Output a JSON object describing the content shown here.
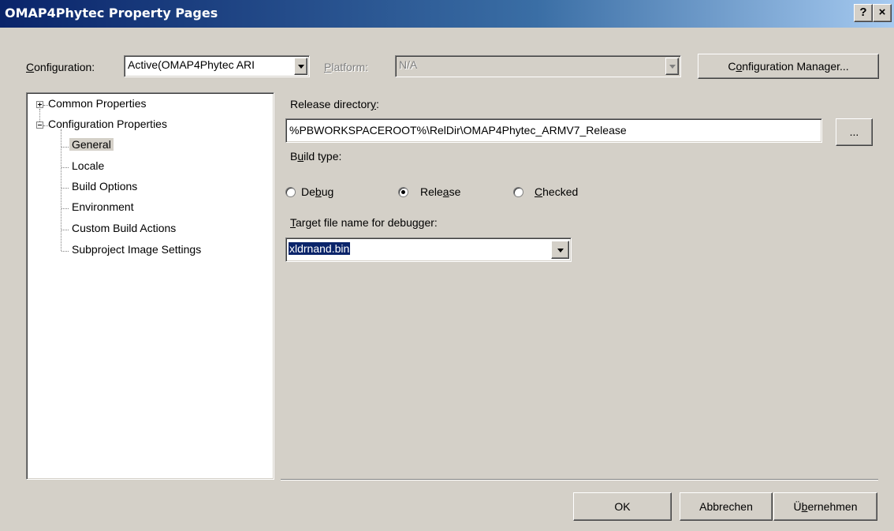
{
  "window": {
    "title": "OMAP4Phytec Property Pages",
    "help_button": "?",
    "close_button": "×"
  },
  "toolbar": {
    "configuration_label": "Configuration:",
    "configuration_value": "Active(OMAP4Phytec ARI",
    "platform_label": "Platform:",
    "platform_value": "N/A",
    "config_manager_button": "Configuration Manager..."
  },
  "tree": {
    "items": [
      {
        "label": "Common Properties",
        "level": 0,
        "expander": "plus"
      },
      {
        "label": "Configuration Properties",
        "level": 0,
        "expander": "minus"
      },
      {
        "label": "General",
        "level": 1,
        "selected": true
      },
      {
        "label": "Locale",
        "level": 1
      },
      {
        "label": "Build Options",
        "level": 1
      },
      {
        "label": "Environment",
        "level": 1
      },
      {
        "label": "Custom Build Actions",
        "level": 1
      },
      {
        "label": "Subproject Image Settings",
        "level": 1
      }
    ]
  },
  "general": {
    "release_dir_label": "Release directory:",
    "release_dir_value": "%PBWORKSPACEROOT%\\RelDir\\OMAP4Phytec_ARMV7_Release",
    "browse_button": "...",
    "build_type_label": "Build type:",
    "build_types": [
      {
        "label": "Debug",
        "checked": false
      },
      {
        "label": "Release",
        "checked": true
      },
      {
        "label": "Checked",
        "checked": false
      }
    ],
    "target_label": "Target file name for debugger:",
    "target_value": "xldrnand.bin"
  },
  "footer": {
    "ok_button": "OK",
    "cancel_button": "Abbrechen",
    "apply_button": "Übernehmen"
  },
  "colors": {
    "titlebar_start": "#0a246a",
    "titlebar_end": "#a6caf0",
    "face": "#d4d0c8",
    "selection": "#0a246a"
  }
}
